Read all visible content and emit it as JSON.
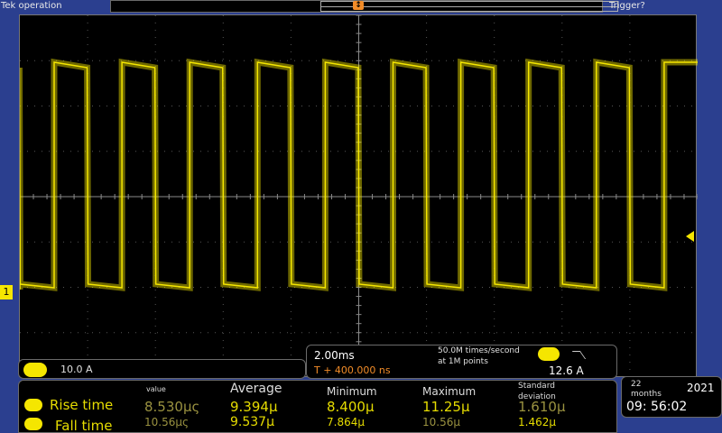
{
  "header": {
    "status": "Tek operation",
    "trigger_status": "Trigger?",
    "trigger_marker": "T"
  },
  "channel": {
    "marker_label": "1",
    "scale": "10.0 A",
    "color": "#f5e600"
  },
  "horizontal": {
    "time_per_div": "2.00ms",
    "trigger_delay": "T + 400.000 ns",
    "sample_rate": "50.0M times/second at 1M points"
  },
  "trigger": {
    "level": "12.6 A",
    "edge": "falling"
  },
  "measurements": {
    "headers": {
      "value": "value",
      "average": "Average",
      "minimum": "Minimum",
      "maximum": "Maximum",
      "stdev": "Standard deviation"
    },
    "rows": [
      {
        "name": "Rise time",
        "value": "8.530μς",
        "average": "9.394μ",
        "minimum": "8.400μ",
        "maximum": "11.25μ",
        "stdev": "1.610μ"
      },
      {
        "name": "Fall time",
        "value": "10.56μς",
        "average": "9.537μ",
        "minimum": "7.864μ",
        "maximum": "10.56μ",
        "stdev": "1.462μ"
      }
    ]
  },
  "datetime": {
    "months": "22 months",
    "year": "2021",
    "time": "09: 56:02"
  },
  "chart_data": {
    "type": "line",
    "title": "",
    "series": [
      {
        "name": "",
        "waveform": "square",
        "cycles": 10
      }
    ],
    "grid": true,
    "divisions": {
      "x": 10,
      "y": 8
    }
  }
}
